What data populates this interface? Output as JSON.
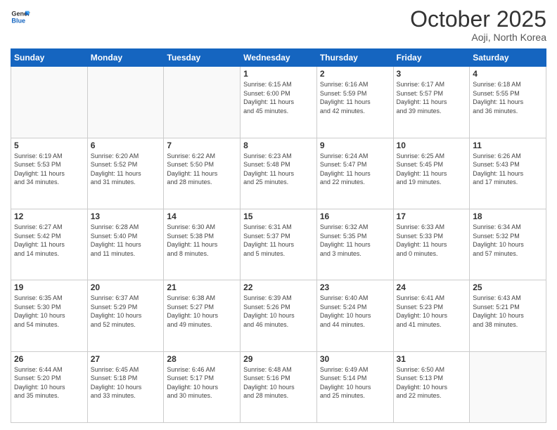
{
  "header": {
    "logo_line1": "General",
    "logo_line2": "Blue",
    "month": "October 2025",
    "location": "Aoji, North Korea"
  },
  "days_of_week": [
    "Sunday",
    "Monday",
    "Tuesday",
    "Wednesday",
    "Thursday",
    "Friday",
    "Saturday"
  ],
  "weeks": [
    [
      {
        "day": "",
        "info": ""
      },
      {
        "day": "",
        "info": ""
      },
      {
        "day": "",
        "info": ""
      },
      {
        "day": "1",
        "info": "Sunrise: 6:15 AM\nSunset: 6:00 PM\nDaylight: 11 hours\nand 45 minutes."
      },
      {
        "day": "2",
        "info": "Sunrise: 6:16 AM\nSunset: 5:59 PM\nDaylight: 11 hours\nand 42 minutes."
      },
      {
        "day": "3",
        "info": "Sunrise: 6:17 AM\nSunset: 5:57 PM\nDaylight: 11 hours\nand 39 minutes."
      },
      {
        "day": "4",
        "info": "Sunrise: 6:18 AM\nSunset: 5:55 PM\nDaylight: 11 hours\nand 36 minutes."
      }
    ],
    [
      {
        "day": "5",
        "info": "Sunrise: 6:19 AM\nSunset: 5:53 PM\nDaylight: 11 hours\nand 34 minutes."
      },
      {
        "day": "6",
        "info": "Sunrise: 6:20 AM\nSunset: 5:52 PM\nDaylight: 11 hours\nand 31 minutes."
      },
      {
        "day": "7",
        "info": "Sunrise: 6:22 AM\nSunset: 5:50 PM\nDaylight: 11 hours\nand 28 minutes."
      },
      {
        "day": "8",
        "info": "Sunrise: 6:23 AM\nSunset: 5:48 PM\nDaylight: 11 hours\nand 25 minutes."
      },
      {
        "day": "9",
        "info": "Sunrise: 6:24 AM\nSunset: 5:47 PM\nDaylight: 11 hours\nand 22 minutes."
      },
      {
        "day": "10",
        "info": "Sunrise: 6:25 AM\nSunset: 5:45 PM\nDaylight: 11 hours\nand 19 minutes."
      },
      {
        "day": "11",
        "info": "Sunrise: 6:26 AM\nSunset: 5:43 PM\nDaylight: 11 hours\nand 17 minutes."
      }
    ],
    [
      {
        "day": "12",
        "info": "Sunrise: 6:27 AM\nSunset: 5:42 PM\nDaylight: 11 hours\nand 14 minutes."
      },
      {
        "day": "13",
        "info": "Sunrise: 6:28 AM\nSunset: 5:40 PM\nDaylight: 11 hours\nand 11 minutes."
      },
      {
        "day": "14",
        "info": "Sunrise: 6:30 AM\nSunset: 5:38 PM\nDaylight: 11 hours\nand 8 minutes."
      },
      {
        "day": "15",
        "info": "Sunrise: 6:31 AM\nSunset: 5:37 PM\nDaylight: 11 hours\nand 5 minutes."
      },
      {
        "day": "16",
        "info": "Sunrise: 6:32 AM\nSunset: 5:35 PM\nDaylight: 11 hours\nand 3 minutes."
      },
      {
        "day": "17",
        "info": "Sunrise: 6:33 AM\nSunset: 5:33 PM\nDaylight: 11 hours\nand 0 minutes."
      },
      {
        "day": "18",
        "info": "Sunrise: 6:34 AM\nSunset: 5:32 PM\nDaylight: 10 hours\nand 57 minutes."
      }
    ],
    [
      {
        "day": "19",
        "info": "Sunrise: 6:35 AM\nSunset: 5:30 PM\nDaylight: 10 hours\nand 54 minutes."
      },
      {
        "day": "20",
        "info": "Sunrise: 6:37 AM\nSunset: 5:29 PM\nDaylight: 10 hours\nand 52 minutes."
      },
      {
        "day": "21",
        "info": "Sunrise: 6:38 AM\nSunset: 5:27 PM\nDaylight: 10 hours\nand 49 minutes."
      },
      {
        "day": "22",
        "info": "Sunrise: 6:39 AM\nSunset: 5:26 PM\nDaylight: 10 hours\nand 46 minutes."
      },
      {
        "day": "23",
        "info": "Sunrise: 6:40 AM\nSunset: 5:24 PM\nDaylight: 10 hours\nand 44 minutes."
      },
      {
        "day": "24",
        "info": "Sunrise: 6:41 AM\nSunset: 5:23 PM\nDaylight: 10 hours\nand 41 minutes."
      },
      {
        "day": "25",
        "info": "Sunrise: 6:43 AM\nSunset: 5:21 PM\nDaylight: 10 hours\nand 38 minutes."
      }
    ],
    [
      {
        "day": "26",
        "info": "Sunrise: 6:44 AM\nSunset: 5:20 PM\nDaylight: 10 hours\nand 35 minutes."
      },
      {
        "day": "27",
        "info": "Sunrise: 6:45 AM\nSunset: 5:18 PM\nDaylight: 10 hours\nand 33 minutes."
      },
      {
        "day": "28",
        "info": "Sunrise: 6:46 AM\nSunset: 5:17 PM\nDaylight: 10 hours\nand 30 minutes."
      },
      {
        "day": "29",
        "info": "Sunrise: 6:48 AM\nSunset: 5:16 PM\nDaylight: 10 hours\nand 28 minutes."
      },
      {
        "day": "30",
        "info": "Sunrise: 6:49 AM\nSunset: 5:14 PM\nDaylight: 10 hours\nand 25 minutes."
      },
      {
        "day": "31",
        "info": "Sunrise: 6:50 AM\nSunset: 5:13 PM\nDaylight: 10 hours\nand 22 minutes."
      },
      {
        "day": "",
        "info": ""
      }
    ]
  ]
}
